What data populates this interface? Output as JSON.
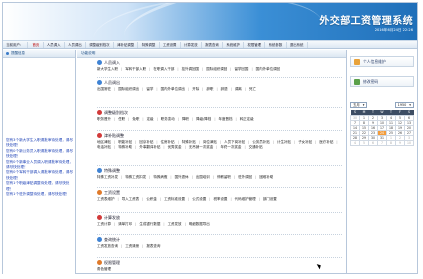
{
  "banner": {
    "title": "外交部工资管理系统",
    "date": "2016年6月24日 22:26"
  },
  "nav": {
    "items": [
      "当前用户：",
      "首页",
      "人员调入",
      "人员调出",
      "调整级别档次",
      "津补贴调整",
      "特殊调整",
      "工资设置",
      "计算发放",
      "报表查询",
      "系统维护",
      "权限管理",
      "系统参数",
      "退出系统"
    ]
  },
  "left_panel": {
    "title": "提醒信息",
    "messages": [
      "您有3个新大学生入职请批审待处理，请尽快处理！",
      "您有0个新公务员入职请批审待处理，请尽快处理！",
      "您有0个新事业人员调入职请批审待处理，请尽快处理！",
      "您有0个军转干部调入请批审待处理，请尽快处理！",
      "您有1个职级津贴调整待处理，请尽快处理！",
      "您有1个驻外调整待处理，请尽快处理！"
    ]
  },
  "main_panel": {
    "title": "功能说明",
    "sections": [
      {
        "title": "人员调入",
        "icon_color": "#3f83d4",
        "links": [
          "新大学生入职",
          "军转干部入职",
          "在职调入干部",
          "挂外调回国",
          "国际组织调回",
          "留学回国",
          "国内外单位调回"
        ]
      },
      {
        "title": "人员调出",
        "icon_color": "#3f83d4",
        "links": [
          "出国常驻",
          "国际组织调出",
          "留学",
          "国内外单位调出",
          "开除",
          "辞职",
          "辞退",
          "调离",
          "死亡"
        ]
      },
      {
        "title": "调整级别档次",
        "icon_color": "#d23a3a",
        "links": [
          "职务晋升",
          "任职",
          "免职",
          "定级",
          "职务变动",
          "降职",
          "降级/降档",
          "年度晋档",
          "转正定级"
        ]
      },
      {
        "title": "津补贴调整",
        "icon_color": "#d23a3a",
        "links": [
          "地区津贴",
          "职能补贴",
          "回京补贴",
          "住房补贴",
          "特殊补贴",
          "岗位津贴",
          "人员下岗补贴",
          "公务员补贴",
          "计生补贴",
          "子女补贴",
          "医疗补贴",
          "电话补贴",
          "特殊补助",
          "外事翻译补贴",
          "优秀奖金",
          "无吊销一次奖金",
          "年终一次奖金",
          "交通补贴"
        ]
      },
      {
        "title": "特殊调整",
        "icon_color": "#3f83d4",
        "links": [
          "特殊工资补发",
          "特殊工资扣发",
          "特殊病假",
          "国外退休",
          "出国培训",
          "停薪留职",
          "驻外调回",
          "困难补助"
        ]
      },
      {
        "title": "工资设置",
        "icon_color": "#e07a2a",
        "links": [
          "工资表维护",
          "导入工资表",
          "公积金",
          "工资标准设置",
          "公式设置",
          "税率设置",
          "代码维护管理",
          "部门设置"
        ]
      },
      {
        "title": "计算发放",
        "icon_color": "#d23a3a",
        "links": [
          "工资计算",
          "清单打印",
          "生成银行数据",
          "工资发放",
          "明细数据导出"
        ]
      },
      {
        "title": "查询统计",
        "icon_color": "#3f83d4",
        "links": [
          "工资发放查询",
          "工资清册",
          "报表查询"
        ]
      },
      {
        "title": "权限管理",
        "icon_color": "#e07a2a",
        "links": [
          "角色管理"
        ]
      }
    ]
  },
  "right_panel": {
    "buttons": [
      {
        "label": "个人信息维护",
        "icon": "user-icon",
        "color": "#e8a23a"
      },
      {
        "label": "修改密码",
        "icon": "key-icon",
        "color": "#5aa04a"
      }
    ],
    "calendar": {
      "month": "五月",
      "year": "1950",
      "weekdays": [
        "S",
        "M",
        "T",
        "W",
        "T",
        "F",
        "S"
      ],
      "rows": [
        [
          "30",
          "1",
          "2",
          "3",
          "4",
          "5",
          "6"
        ],
        [
          "7",
          "8",
          "9",
          "10",
          "11",
          "12",
          "13"
        ],
        [
          "14",
          "15",
          "16",
          "17",
          "18",
          "19",
          "20"
        ],
        [
          "21",
          "22",
          "23",
          "24",
          "25",
          "26",
          "27"
        ],
        [
          "28",
          "29",
          "30",
          "31",
          "1",
          "2",
          "3"
        ],
        [
          "4",
          "5",
          "6",
          "7",
          "8",
          "9",
          "10"
        ]
      ],
      "today": "24"
    }
  }
}
